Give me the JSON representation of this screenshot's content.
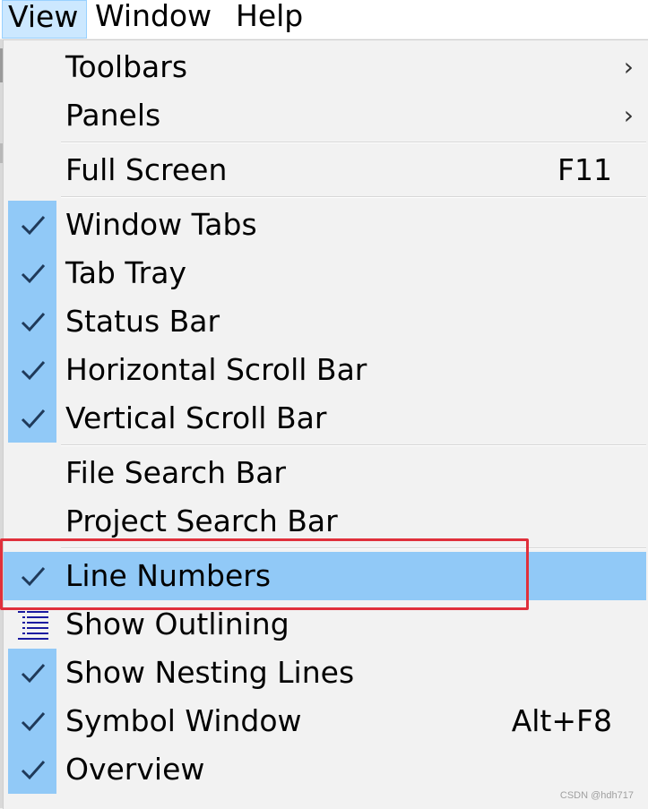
{
  "menubar": {
    "items": [
      "View",
      "Window",
      "Help"
    ],
    "active": "View"
  },
  "menu": {
    "toolbars": "Toolbars",
    "panels": "Panels",
    "full_screen": "Full Screen",
    "full_screen_shortcut": "F11",
    "window_tabs": "Window Tabs",
    "tab_tray": "Tab Tray",
    "status_bar": "Status Bar",
    "horizontal_scroll_bar": "Horizontal Scroll Bar",
    "vertical_scroll_bar": "Vertical Scroll Bar",
    "file_search_bar": "File Search Bar",
    "project_search_bar": "Project Search Bar",
    "line_numbers": "Line Numbers",
    "show_outlining": "Show Outlining",
    "show_nesting_lines": "Show Nesting Lines",
    "symbol_window": "Symbol Window",
    "symbol_window_shortcut": "Alt+F8",
    "overview": "Overview"
  },
  "checked": {
    "window_tabs": true,
    "tab_tray": true,
    "status_bar": true,
    "horizontal_scroll_bar": true,
    "vertical_scroll_bar": true,
    "line_numbers": true,
    "show_nesting_lines": true,
    "symbol_window": true,
    "overview": true
  },
  "icons": {
    "submenu": "chevron-right-icon",
    "check": "checkmark-icon",
    "outlining": "outline-list-icon"
  },
  "colors": {
    "highlight": "#91c9f7",
    "annotation_box": "#e0303b"
  },
  "watermark": "CSDN @hdh717"
}
